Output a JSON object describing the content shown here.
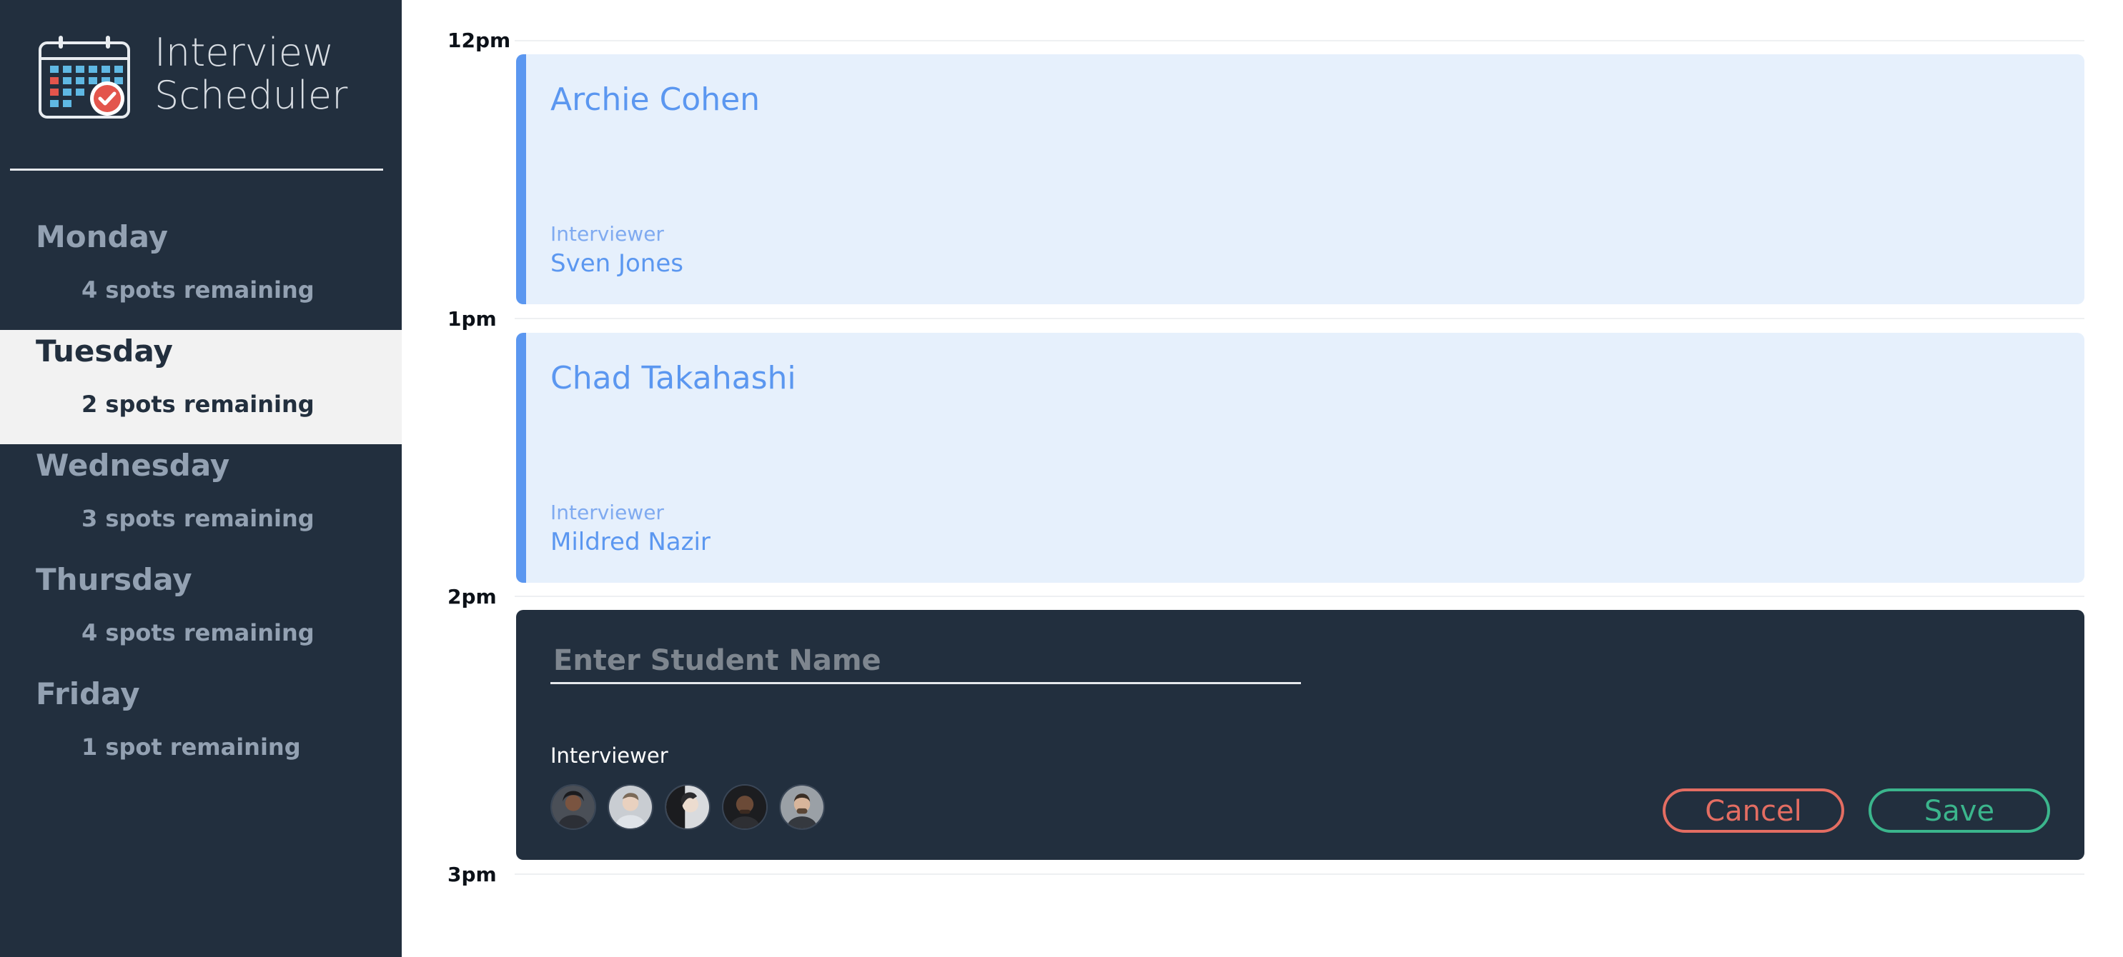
{
  "app": {
    "brand_line1": "Interview",
    "brand_line2": "Scheduler",
    "logo_icon": "calendar-check-icon"
  },
  "sidebar": {
    "days": [
      {
        "name": "Monday",
        "spots": "4 spots remaining",
        "selected": false
      },
      {
        "name": "Tuesday",
        "spots": "2 spots remaining",
        "selected": true
      },
      {
        "name": "Wednesday",
        "spots": "3 spots remaining",
        "selected": false
      },
      {
        "name": "Thursday",
        "spots": "4 spots remaining",
        "selected": false
      },
      {
        "name": "Friday",
        "spots": "1 spot remaining",
        "selected": false
      }
    ]
  },
  "schedule": {
    "times": [
      "12pm",
      "1pm",
      "2pm",
      "3pm"
    ],
    "appointments": [
      {
        "student": "Archie Cohen",
        "interviewer_label": "Interviewer",
        "interviewer": "Sven Jones"
      },
      {
        "student": "Chad Takahashi",
        "interviewer_label": "Interviewer",
        "interviewer": "Mildred Nazir"
      }
    ],
    "form": {
      "placeholder": "Enter Student Name",
      "interviewer_label": "Interviewer",
      "avatar_count": 5,
      "cancel_label": "Cancel",
      "save_label": "Save"
    }
  },
  "colors": {
    "sidebar_bg": "#222f3e",
    "selected_bg": "#f2f2f2",
    "appointment_bg": "#e6f0fc",
    "appointment_accent": "#5b97f0",
    "cancel": "#e36d62",
    "save": "#3bb58c"
  }
}
